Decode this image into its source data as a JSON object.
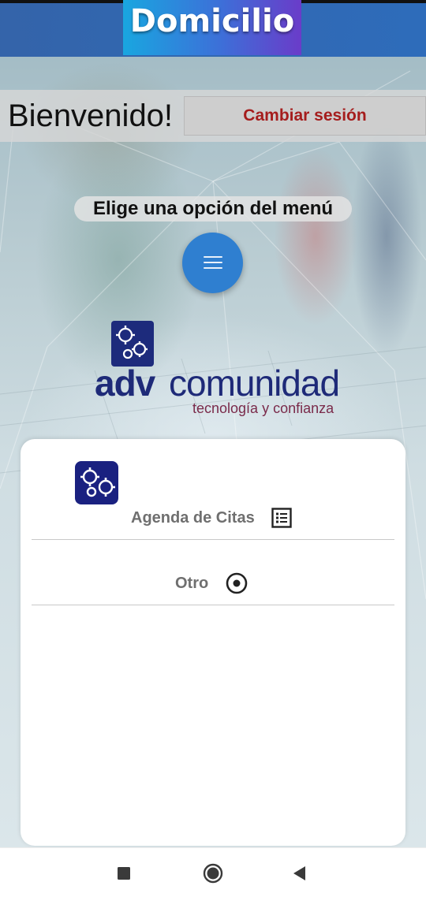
{
  "header": {
    "title": "Domicilio",
    "accent_colors": [
      "#19a6e0",
      "#3d6fd8",
      "#6a3cc9"
    ],
    "bar_color": "#2868ba"
  },
  "welcome": {
    "greeting": "Bienvenido!",
    "session_button_label": "Cambiar sesión",
    "session_button_color": "#a51d1d"
  },
  "menu": {
    "prompt": "Elige una opción del menú",
    "fab_icon": "menu-icon",
    "fab_color": "#2f7fd0"
  },
  "logo": {
    "icon": "gears-icon",
    "brand_part1": "adv",
    "brand_part2": "comunidad",
    "tagline": "tecnología y confianza",
    "brand_color": "#1e2a78"
  },
  "sheet": {
    "app_icon": "gears-icon",
    "items": [
      {
        "label": "Agenda de Citas",
        "icon": "list-icon"
      },
      {
        "label": "Otro",
        "icon": "radio-target-icon"
      }
    ]
  },
  "navbar": {
    "buttons": [
      {
        "icon": "square-recents-icon"
      },
      {
        "icon": "circle-home-icon"
      },
      {
        "icon": "triangle-back-icon"
      }
    ]
  }
}
